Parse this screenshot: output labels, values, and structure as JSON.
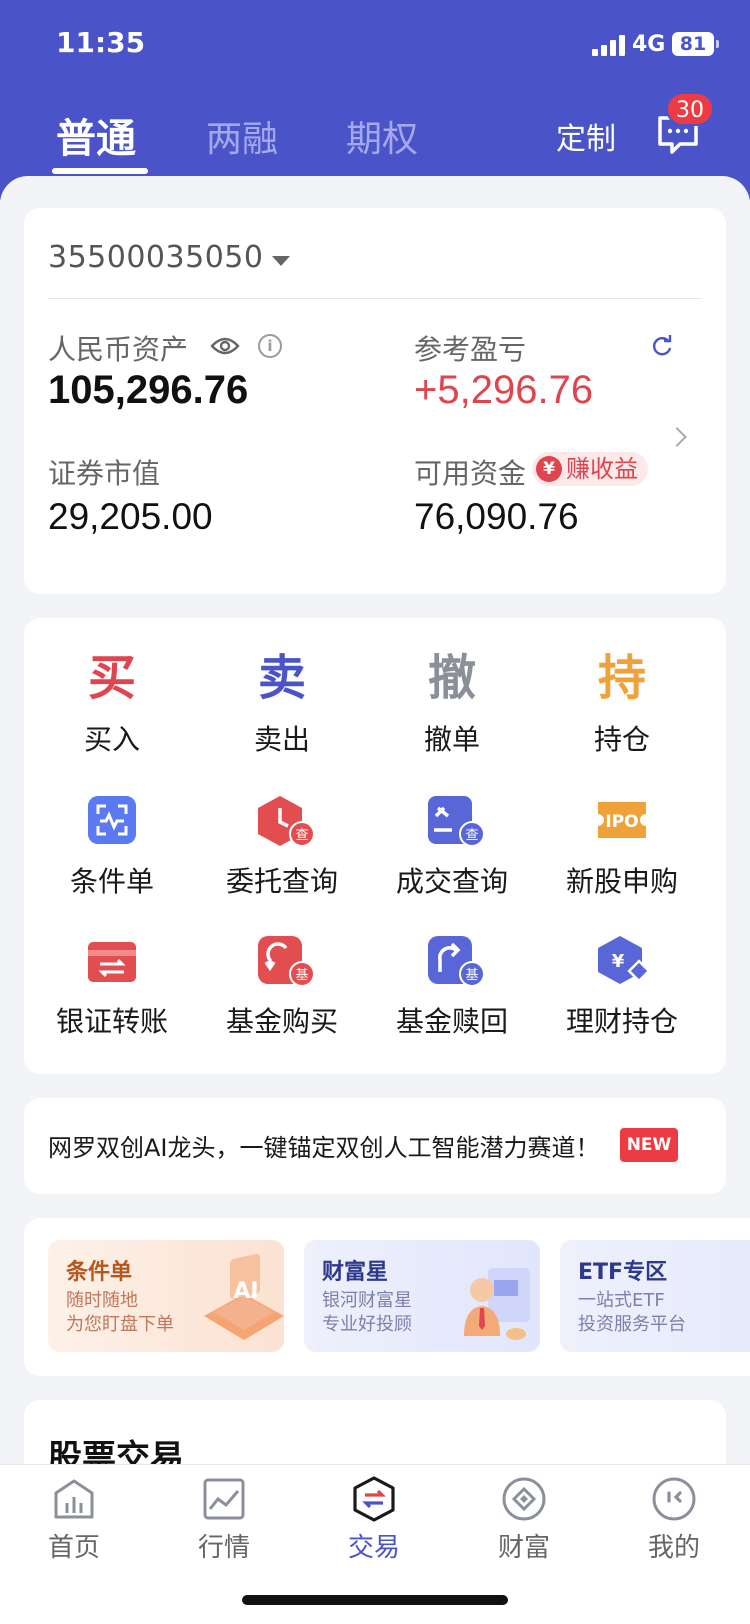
{
  "status_bar": {
    "time": "11:35",
    "network": "4G",
    "battery": "81"
  },
  "tabs": [
    {
      "label": "普通",
      "active": true
    },
    {
      "label": "两融",
      "active": false
    },
    {
      "label": "期权",
      "active": false
    }
  ],
  "header": {
    "customize_label": "定制",
    "message_badge": "30"
  },
  "account": {
    "number": "35500035050",
    "rmb_assets_label": "人民币资产",
    "rmb_assets_value": "105,296.76",
    "ref_pnl_label": "参考盈亏",
    "ref_pnl_value": "+5,296.76",
    "market_value_label": "证券市值",
    "market_value": "29,205.00",
    "available_label": "可用资金",
    "available_value": "76,090.76",
    "earn_badge": "赚收益",
    "earn_symbol": "¥"
  },
  "functions": {
    "row1": [
      {
        "char": "买",
        "label": "买入",
        "color": "#e0444d"
      },
      {
        "char": "卖",
        "label": "卖出",
        "color": "#4a54c8"
      },
      {
        "char": "撤",
        "label": "撤单",
        "color": "#8a8f99"
      },
      {
        "char": "持",
        "label": "持仓",
        "color": "#f0a23a"
      }
    ],
    "row2": [
      {
        "label": "条件单",
        "icon": "condition-scan-icon"
      },
      {
        "label": "委托查询",
        "icon": "order-query-icon",
        "badge": "查"
      },
      {
        "label": "成交查询",
        "icon": "trade-query-icon",
        "badge": "查"
      },
      {
        "label": "新股申购",
        "icon": "ipo-icon",
        "text": "IPO"
      }
    ],
    "row3": [
      {
        "label": "银证转账",
        "icon": "bank-transfer-icon"
      },
      {
        "label": "基金购买",
        "icon": "fund-buy-icon",
        "badge": "基"
      },
      {
        "label": "基金赎回",
        "icon": "fund-redeem-icon",
        "badge": "基"
      },
      {
        "label": "理财持仓",
        "icon": "wealth-holding-icon",
        "text": "¥"
      }
    ]
  },
  "banner": {
    "text": "网罗双创AI龙头，一键锚定双创人工智能潜力赛道！",
    "badge": "NEW"
  },
  "promos": [
    {
      "title": "条件单",
      "line1": "随时随地",
      "line2": "为您盯盘下单",
      "art_text": "AI"
    },
    {
      "title": "财富星",
      "line1": "银河财富星",
      "line2": "专业好投顾"
    },
    {
      "title": "ETF专区",
      "line1": "一站式ETF",
      "line2": "投资服务平台"
    }
  ],
  "section": {
    "title": "股票交易"
  },
  "bottom_nav": [
    {
      "label": "首页",
      "icon": "home-icon",
      "active": false
    },
    {
      "label": "行情",
      "icon": "market-icon",
      "active": false
    },
    {
      "label": "交易",
      "icon": "trade-icon",
      "active": true
    },
    {
      "label": "财富",
      "icon": "wealth-icon",
      "active": false
    },
    {
      "label": "我的",
      "icon": "profile-icon",
      "active": false
    }
  ],
  "colors": {
    "brand": "#4a54c8",
    "red": "#e0444d",
    "orange": "#f0a23a"
  }
}
